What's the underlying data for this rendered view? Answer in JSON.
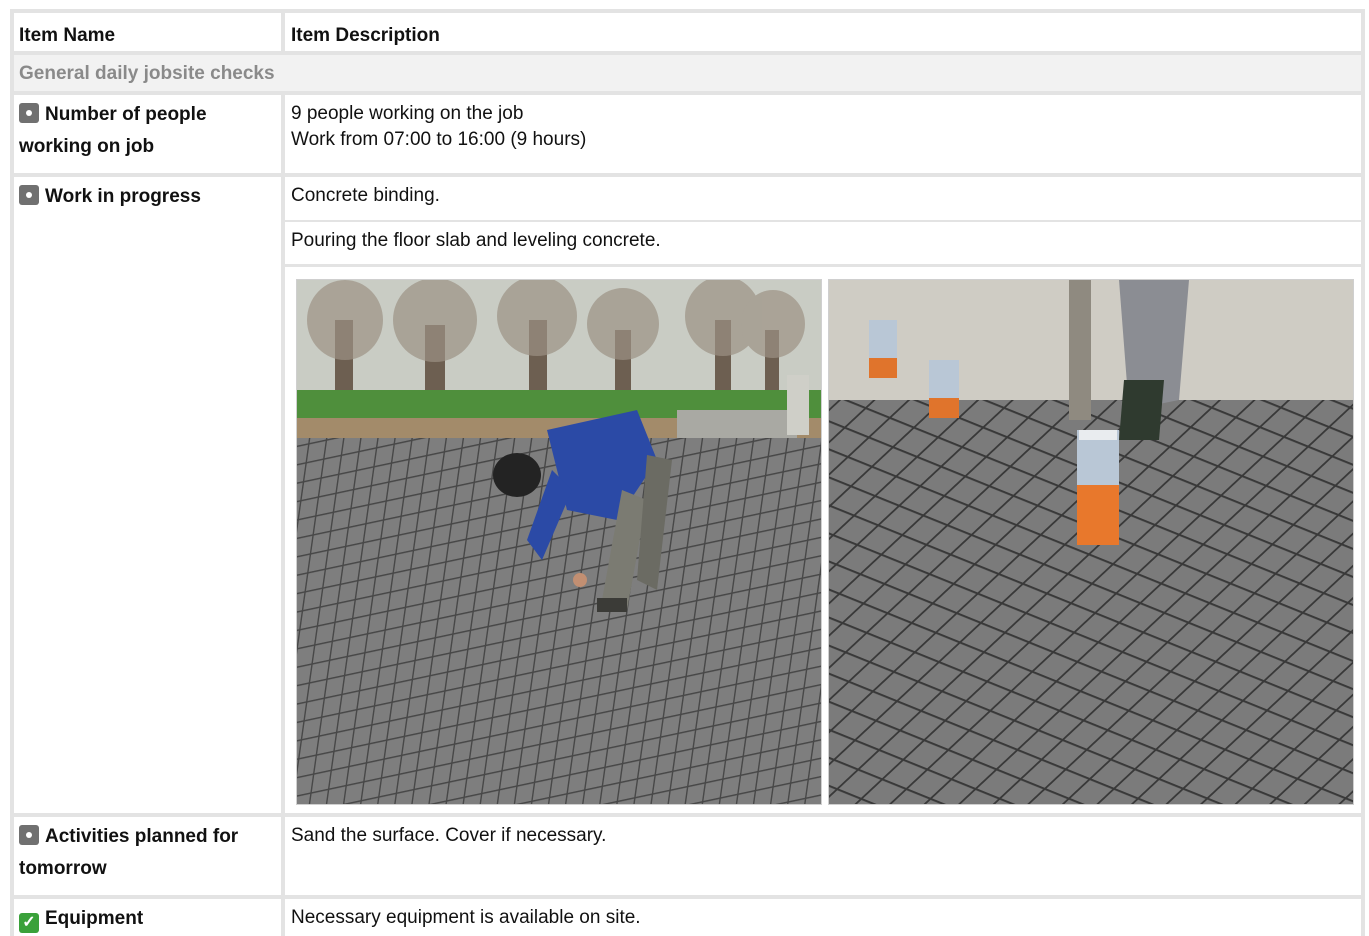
{
  "table": {
    "col_name_header": "Item Name",
    "col_desc_header": "Item Description"
  },
  "section": {
    "title": "General daily jobsite checks"
  },
  "rows": [
    {
      "name": "Number of people working on job",
      "status": "neutral",
      "lines": [
        "9 people working on the job",
        "Work from 07:00 to 16:00 (9 hours)"
      ]
    },
    {
      "name": "Work in progress",
      "status": "neutral",
      "lines": [
        "Concrete binding.",
        "Pouring the floor slab and leveling concrete."
      ]
    },
    {
      "name": "Activities planned for tomorrow",
      "status": "neutral",
      "lines": [
        "Sand the surface. Cover if necessary."
      ]
    },
    {
      "name": "Equipment",
      "status": "ok",
      "status_symbol": "✓",
      "lines": [
        "Necessary equipment is available on site."
      ]
    }
  ],
  "colors": {
    "border_gray": "#e3e3e3",
    "section_text": "#8a8a8a",
    "status_neutral": "#707070",
    "status_ok": "#3aa13a"
  },
  "icons": [
    "status-neutral-icon",
    "checkmark-icon"
  ]
}
